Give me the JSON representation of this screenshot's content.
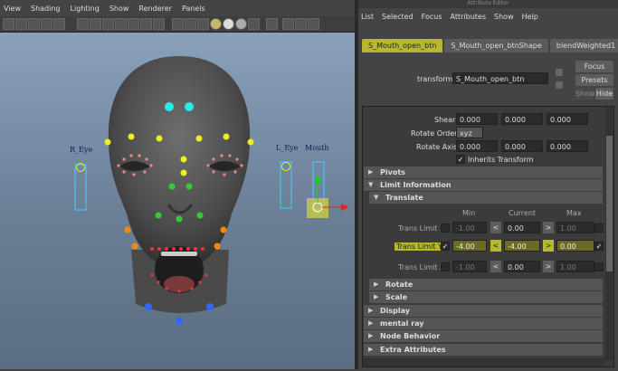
{
  "viewport": {
    "menu": [
      "View",
      "Shading",
      "Lighting",
      "Show",
      "Renderer",
      "Panels"
    ],
    "controls": {
      "r_eye": "R_Eye",
      "l_eye": "L_Eye",
      "mouth": "Mouth"
    }
  },
  "ae": {
    "title": "Attribute Editor",
    "menu": [
      "List",
      "Selected",
      "Focus",
      "Attributes",
      "Show",
      "Help"
    ],
    "tabs": [
      "S_Mouth_open_btn",
      "S_Mouth_open_btnShape",
      "blendWeighted1"
    ],
    "transform_label": "transform:",
    "transform_value": "S_Mouth_open_btn",
    "buttons": {
      "focus": "Focus",
      "presets": "Presets",
      "show": "Show",
      "hide": "Hide"
    },
    "shear": {
      "label": "Shear",
      "values": [
        "0.000",
        "0.000",
        "0.000"
      ]
    },
    "rotate_order": {
      "label": "Rotate Order",
      "value": "xyz"
    },
    "rotate_axis": {
      "label": "Rotate Axis",
      "values": [
        "0.000",
        "0.000",
        "0.000"
      ]
    },
    "inherits": "Inherits Transform",
    "sections": {
      "pivots": "Pivots",
      "limit": "Limit Information",
      "translate": "Translate",
      "rotate": "Rotate",
      "scale": "Scale",
      "display": "Display",
      "mental_ray": "mental ray",
      "node_behavior": "Node Behavior",
      "extra": "Extra Attributes"
    },
    "cols": {
      "min": "Min",
      "current": "Current",
      "max": "Max"
    },
    "limits": [
      {
        "label": "Trans Limit X",
        "min": "-1.00",
        "current": "0.00",
        "max": "1.00"
      },
      {
        "label": "Trans Limit Y",
        "min": "-4.00",
        "current": "-4.00",
        "max": "0.00"
      },
      {
        "label": "Trans Limit Z",
        "min": "-1.00",
        "current": "0.00",
        "max": "1.00"
      }
    ]
  }
}
